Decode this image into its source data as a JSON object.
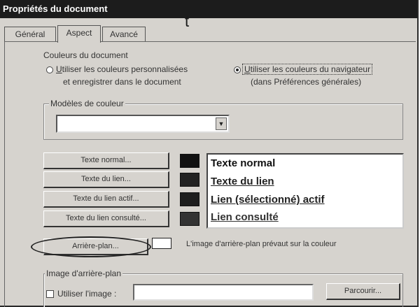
{
  "window": {
    "title": "Propriétés du document"
  },
  "stray_text": "t",
  "tabs": [
    {
      "label": "Général"
    },
    {
      "label": "Aspect"
    },
    {
      "label": "Avancé"
    }
  ],
  "colors_section": {
    "title": "Couleurs du document",
    "option_custom": {
      "prefix": "U",
      "line1": "tiliser les couleurs personnalisées",
      "line2": "et enregistrer dans le document",
      "checked": false
    },
    "option_browser": {
      "prefix": "U",
      "line1": "tiliser les couleurs du navigateur",
      "line2": "(dans Préférences générales)",
      "checked": true
    }
  },
  "schemes": {
    "title": "Modèles de couleur",
    "selected": ""
  },
  "color_buttons": {
    "normal_text": {
      "label": "Texte normal...",
      "color": "#111111"
    },
    "link_text": {
      "label": "Texte du lien...",
      "color": "#222222"
    },
    "active_link": {
      "label": "Texte du lien actif...",
      "color": "#1e1e1e"
    },
    "visited_link": {
      "label": "Texte du lien consulté...",
      "color": "#333333"
    },
    "background": {
      "label": "Arrière-plan...",
      "color": "#ffffff"
    }
  },
  "preview": {
    "normal": "Texte normal",
    "link": "Texte du lien",
    "active": "Lien (sélectionné) actif",
    "visited": "Lien consulté"
  },
  "background_note": "L'image d'arrière-plan prévaut sur la couleur",
  "bg_image_section": {
    "title": "Image d'arrière-plan",
    "use_image_label": "Utiliser l'image :",
    "use_image_checked": false,
    "path_value": "",
    "browse_label": "Parcourir..."
  }
}
